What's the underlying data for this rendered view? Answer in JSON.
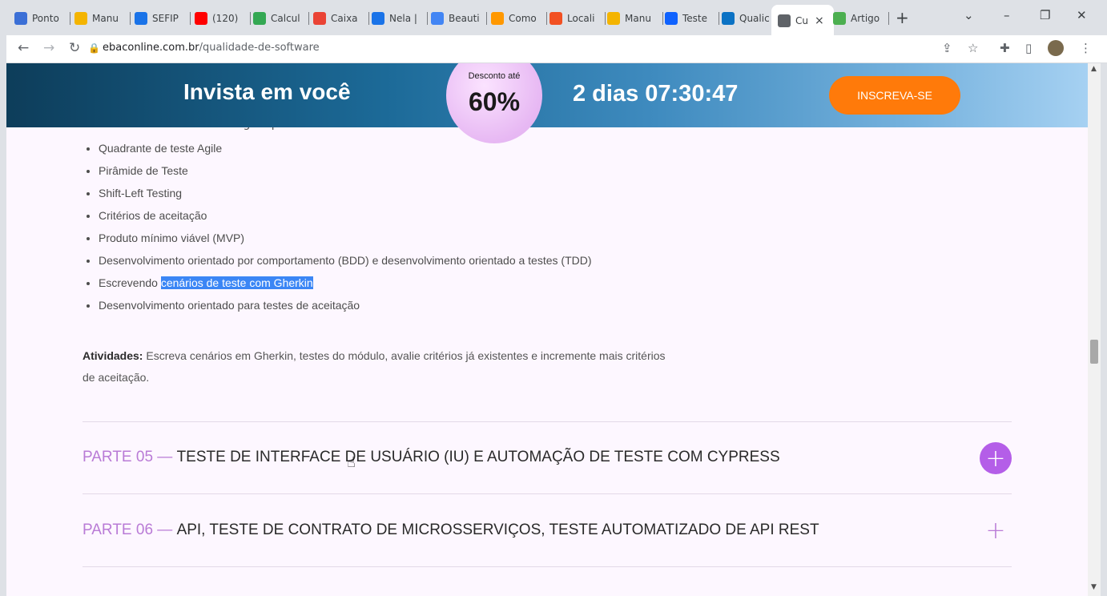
{
  "tabs": [
    {
      "label": "Ponto",
      "color": "#3b6fd6"
    },
    {
      "label": "Manu",
      "color": "#f4b400"
    },
    {
      "label": "SEFIP",
      "color": "#1a73e8"
    },
    {
      "label": "(120)",
      "color": "#ff0000"
    },
    {
      "label": "Calcul",
      "color": "#34a853"
    },
    {
      "label": "Caixa",
      "color": "#ea4335"
    },
    {
      "label": "Nela |",
      "color": "#1a73e8"
    },
    {
      "label": "Beauti",
      "color": "#4285f4"
    },
    {
      "label": "Como",
      "color": "#ff9800"
    },
    {
      "label": "Locali",
      "color": "#f25022"
    },
    {
      "label": "Manu",
      "color": "#f4b400"
    },
    {
      "label": "Teste",
      "color": "#0f62fe"
    },
    {
      "label": "Qualic",
      "color": "#0b72c4"
    },
    {
      "label": "Cu",
      "color": "#5f6368"
    },
    {
      "label": "Artigo",
      "color": "#4caf50"
    }
  ],
  "active_tab_close": "×",
  "new_tab": "+",
  "window_controls": {
    "dropdown": "⌄",
    "minimize": "–",
    "restore": "❐",
    "close": "✕"
  },
  "toolbar": {
    "back": "←",
    "forward": "→",
    "reload": "↻",
    "url_domain": "ebaconline.com.br",
    "url_path": "/qualidade-de-software"
  },
  "banner": {
    "title": "Invista em você",
    "discount_small": "Desconto até",
    "discount_big": "60%",
    "countdown": "2 dias 07:30:47",
    "cta": "INSCREVA-SE"
  },
  "ghost_item": "Gerenciamento do Backlog do produto",
  "topics": [
    "Quadrante de teste Agile",
    "Pirâmide de Teste",
    "Shift-Left Testing",
    "Critérios de aceitação",
    "Produto mínimo viável (MVP)",
    "Desenvolvimento orientado por comportamento (BDD) e desenvolvimento orientado a testes (TDD)"
  ],
  "gherkin_item": {
    "prefix": "Escrevendo ",
    "highlight": "cenários de teste com Gherkin"
  },
  "last_topic": "Desenvolvimento orientado para testes de aceitação",
  "activities": {
    "label": "Atividades:",
    "text": " Escreva cenários em Gherkin, testes do módulo, avalie critérios já existentes e incremente mais critérios de aceitação."
  },
  "sections": [
    {
      "part": "PARTE 05 — ",
      "title": "TESTE DE INTERFACE DE USUÁRIO (IU) E AUTOMAÇÃO DE TESTE COM CYPRESS",
      "toggle": "+"
    },
    {
      "part": "PARTE 06 — ",
      "title": "API, TESTE DE CONTRATO DE MICROSSERVIÇOS, TESTE AUTOMATIZADO DE API REST",
      "toggle": "+"
    }
  ]
}
